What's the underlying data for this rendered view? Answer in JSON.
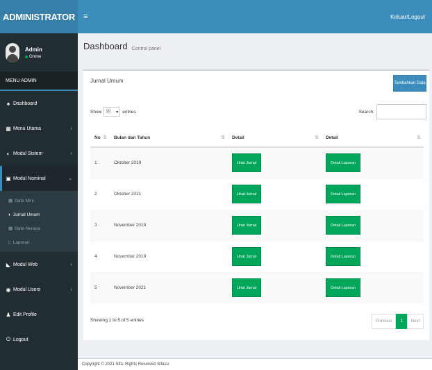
{
  "brand": "ADMINISTRATOR",
  "navbar": {
    "toggle": "≡",
    "signout": "Keluar/Logout"
  },
  "user": {
    "name": "Admin",
    "status": "Online"
  },
  "sidebar": {
    "header": "MENU ADMIN",
    "items": [
      {
        "icon": "♠",
        "label": "Dashboard",
        "chevron": ""
      },
      {
        "icon": "▦",
        "label": "Menu Utama",
        "chevron": "‹"
      },
      {
        "icon": "◐",
        "label": "Modul Sistem",
        "chevron": "‹"
      },
      {
        "icon": "▣",
        "label": "Modul Nominal",
        "chevron": "⌄"
      }
    ],
    "sub_items": [
      {
        "icon": "▦",
        "label": "Data Mini"
      },
      {
        "icon": "◐",
        "label": "Jurnal Umum"
      },
      {
        "icon": "▦",
        "label": "Data Neraca"
      },
      {
        "icon": "▯",
        "label": "Laporan"
      }
    ],
    "items_after": [
      {
        "icon": "◣",
        "label": "Modul Web",
        "chevron": "‹"
      },
      {
        "icon": "◉",
        "label": "Modul Users",
        "chevron": "‹"
      },
      {
        "icon": "♟",
        "label": "Edit Profile",
        "chevron": ""
      },
      {
        "icon": "⏻",
        "label": "Logout",
        "chevron": ""
      }
    ]
  },
  "page": {
    "title": "Dashboard",
    "subtitle": "Control panel"
  },
  "box": {
    "title": "Jurnal Umum",
    "add_button": "Tambahkan Data",
    "show_label": "Show",
    "show_value": "10",
    "entries_label": "entries",
    "search_label": "Search:"
  },
  "table": {
    "columns": [
      "No",
      "Bulan dan Tahun",
      "Detail",
      "Detail"
    ],
    "rows": [
      {
        "no": "1",
        "period": "Oktober 2019",
        "btn1": "Lihat Jurnal",
        "btn2": "Detail Laporan"
      },
      {
        "no": "2",
        "period": "Oktober 2021",
        "btn1": "Lihat Jurnal",
        "btn2": "Detail Laporan"
      },
      {
        "no": "3",
        "period": "November 2019",
        "btn1": "Lihat Jurnal",
        "btn2": "Detail Laporan"
      },
      {
        "no": "4",
        "period": "November 2019",
        "btn1": "Lihat Jurnal",
        "btn2": "Detail Laporan"
      },
      {
        "no": "5",
        "period": "November 2021",
        "btn1": "Lihat Jurnal",
        "btn2": "Detail Laporan"
      }
    ]
  },
  "info": "Showing 1 to 5 of 5 entries",
  "pagination": {
    "previous": "Previous",
    "current": "1",
    "next": "Next"
  },
  "footer": "Copyright © 2021 Sifa. Rights Reserved Sifasu"
}
